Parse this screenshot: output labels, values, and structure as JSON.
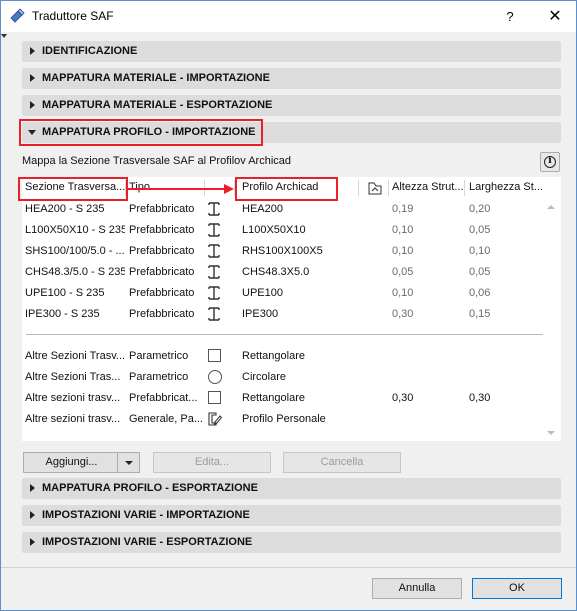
{
  "window": {
    "title": "Traduttore SAF",
    "help_label": "?",
    "close_label": "✕"
  },
  "sections": [
    {
      "label": "IDENTIFICAZIONE",
      "expanded": false
    },
    {
      "label": "MAPPATURA MATERIALE - IMPORTAZIONE",
      "expanded": false
    },
    {
      "label": "MAPPATURA MATERIALE - ESPORTAZIONE",
      "expanded": false
    },
    {
      "label": "MAPPATURA PROFILO - IMPORTAZIONE",
      "expanded": true
    },
    {
      "label": "MAPPATURA PROFILO - ESPORTAZIONE",
      "expanded": false
    },
    {
      "label": "IMPOSTAZIONI VARIE - IMPORTAZIONE",
      "expanded": false
    },
    {
      "label": "IMPOSTAZIONI VARIE - ESPORTAZIONE",
      "expanded": false
    }
  ],
  "panel": {
    "subtitle": "Mappa la Sezione Trasversale SAF al Profilov Archicad",
    "info_icon": "info-icon"
  },
  "table": {
    "columns": {
      "section": "Sezione Trasversa...",
      "type": "Tipo",
      "profile": "Profilo Archicad",
      "height": "Altezza Strut...",
      "width": "Larghezza St..."
    },
    "rows": [
      {
        "section": "HEA200 - S 235",
        "type": "Prefabbricato",
        "icon": "i-beam-icon",
        "profile": "HEA200",
        "height": "0,19",
        "width": "0,20"
      },
      {
        "section": "L100X50X10 - S 235",
        "type": "Prefabbricato",
        "icon": "i-beam-icon",
        "profile": "L100X50X10",
        "height": "0,10",
        "width": "0,05"
      },
      {
        "section": "SHS100/100/5.0 - ...",
        "type": "Prefabbricato",
        "icon": "i-beam-icon",
        "profile": "RHS100X100X5",
        "height": "0,10",
        "width": "0,10"
      },
      {
        "section": "CHS48.3/5.0 - S 235",
        "type": "Prefabbricato",
        "icon": "i-beam-icon",
        "profile": "CHS48.3X5.0",
        "height": "0,05",
        "width": "0,05"
      },
      {
        "section": "UPE100 - S 235",
        "type": "Prefabbricato",
        "icon": "i-beam-icon",
        "profile": "UPE100",
        "height": "0,10",
        "width": "0,06"
      },
      {
        "section": "IPE300 - S 235",
        "type": "Prefabbricato",
        "icon": "i-beam-icon",
        "profile": "IPE300",
        "height": "0,30",
        "width": "0,15"
      }
    ],
    "other_rows": [
      {
        "section": "Altre Sezioni Trasv...",
        "type": "Parametrico",
        "icon": "square-icon",
        "profile": "Rettangolare",
        "height": "",
        "width": ""
      },
      {
        "section": "Altre Sezioni Tras...",
        "type": "Parametrico",
        "icon": "circle-icon",
        "profile": "Circolare",
        "height": "",
        "width": ""
      },
      {
        "section": "Altre sezioni trasv...",
        "type": "Prefabbricat...",
        "icon": "square-icon",
        "profile": "Rettangolare",
        "height": "0,30",
        "width": "0,30"
      },
      {
        "section": "Altre sezioni trasv...",
        "type": "Generale, Pa...",
        "icon": "custom-profile-icon",
        "profile": "Profilo Personale",
        "height": "",
        "width": ""
      }
    ]
  },
  "buttons": {
    "add": "Aggiungi...",
    "edit": "Edita...",
    "delete": "Cancella",
    "cancel": "Annulla",
    "ok": "OK"
  },
  "colors": {
    "highlight": "#e8202a",
    "section_bg": "#dcdcdc",
    "primary_border": "#0078d7"
  }
}
